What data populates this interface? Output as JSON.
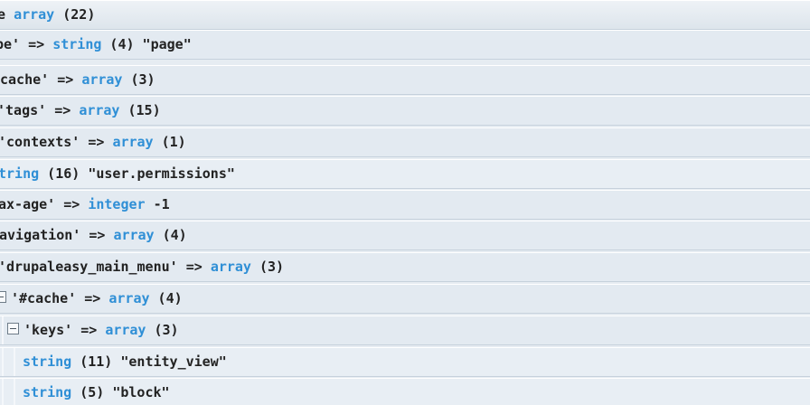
{
  "rows": [
    {
      "pre": "e ",
      "type": "array",
      "post": " (22)"
    },
    {
      "pre": "pe' => ",
      "type": "string",
      "post": " (4) \"page\""
    },
    {
      "pre": "cache' => ",
      "type": "array",
      "post": " (3)"
    },
    {
      "pre": "'tags' => ",
      "type": "array",
      "post": " (15)"
    },
    {
      "pre": "'contexts' => ",
      "type": "array",
      "post": " (1)"
    },
    {
      "pre": "",
      "type": "tring",
      "post": " (16) \"user.permissions\""
    },
    {
      "pre": "ax-age' => ",
      "type": "integer",
      "post": " -1"
    },
    {
      "pre": "avigation' => ",
      "type": "array",
      "post": " (4)"
    },
    {
      "pre": "'drupaleasy_main_menu' => ",
      "type": "array",
      "post": " (3)"
    },
    {
      "pre": "'#cache' => ",
      "type": "array",
      "post": " (4)"
    },
    {
      "pre": "'keys' => ",
      "type": "array",
      "post": " (3)"
    },
    {
      "pre": "",
      "type": "string",
      "post": " (11) \"entity_view\""
    },
    {
      "pre": "",
      "type": "string",
      "post": " (5) \"block\""
    }
  ]
}
